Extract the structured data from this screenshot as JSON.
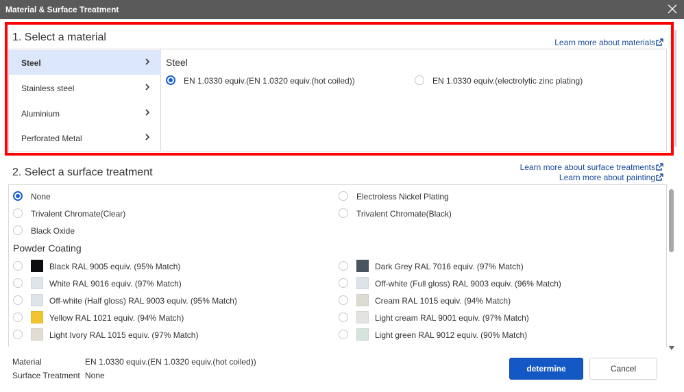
{
  "dialog": {
    "title": "Material & Surface Treatment"
  },
  "material": {
    "section_title": "1. Select a material",
    "learn_more": "Learn more about materials",
    "categories": [
      {
        "label": "Steel",
        "active": true
      },
      {
        "label": "Stainless steel",
        "active": false
      },
      {
        "label": "Aluminium",
        "active": false
      },
      {
        "label": "Perforated Metal",
        "active": false
      }
    ],
    "detail_heading": "Steel",
    "options": [
      {
        "label": "EN 1.0330 equiv.(EN 1.0320 equiv.(hot coiled))",
        "selected": true
      },
      {
        "label": "EN 1.0330 equiv.(electrolytic zinc plating)",
        "selected": false
      }
    ]
  },
  "surface": {
    "section_title": "2. Select a surface treatment",
    "learn_more_surface": "Learn more about surface treatments",
    "learn_more_painting": "Learn more about painting",
    "basic_options": [
      {
        "label": "None",
        "selected": true
      },
      {
        "label": "Electroless Nickel Plating",
        "selected": false
      },
      {
        "label": "Trivalent Chromate(Clear)",
        "selected": false
      },
      {
        "label": "Trivalent Chromate(Black)",
        "selected": false
      },
      {
        "label": "Black Oxide",
        "selected": false
      }
    ],
    "powder_heading": "Powder Coating",
    "powder_options": [
      {
        "label": "Black RAL 9005 equiv. (95% Match)",
        "color": "#0e0e10"
      },
      {
        "label": "Dark Grey RAL 7016 equiv. (97% Match)",
        "color": "#4a545e"
      },
      {
        "label": "White RAL 9016 equiv. (97% Match)",
        "color": "#dfe5eb"
      },
      {
        "label": "Off-white (Full gloss) RAL 9003 equiv. (96% Match)",
        "color": "#dee3ea"
      },
      {
        "label": "Off-white (Half gloss) RAL 9003 equiv. (95% Match)",
        "color": "#dfe3ea"
      },
      {
        "label": "Cream RAL 1015 equiv. (94% Match)",
        "color": "#dddcd2"
      },
      {
        "label": "Yellow RAL 1021 equiv. (94% Match)",
        "color": "#f2c530"
      },
      {
        "label": "Light cream RAL 9001 equiv. (97% Match)",
        "color": "#e3e3e1"
      },
      {
        "label": "Light Ivory RAL 1015 equiv. (97% Match)",
        "color": "#e2ddd2"
      },
      {
        "label": "Light green RAL 9012 equiv. (90% Match)",
        "color": "#d5e5dd"
      }
    ]
  },
  "summary": {
    "material_label": "Material",
    "material_value": "EN 1.0330 equiv.(EN 1.0320 equiv.(hot coiled))",
    "surface_label": "Surface Treatment",
    "surface_value": "None"
  },
  "buttons": {
    "determine": "determine",
    "cancel": "Cancel"
  },
  "colors": {
    "accent": "#1458c6",
    "link": "#1a4a9c",
    "highlight_border": "#ff0000",
    "active_item_bg": "#dde7fb"
  }
}
